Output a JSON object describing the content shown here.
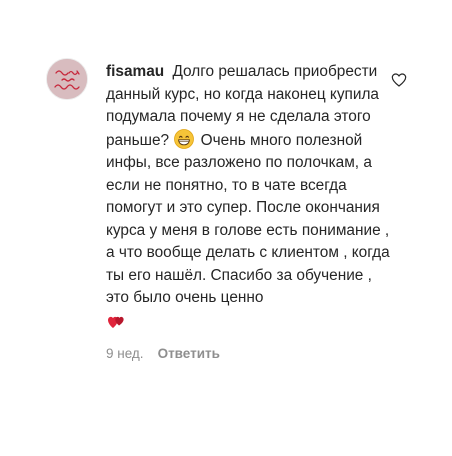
{
  "comment": {
    "username": "fisamau",
    "text_part1": "Долго решалась приобрести данный курс, но когда наконец купила подумала почему я не сделала этого раньше?",
    "emoji1_icon": "grinning-face-icon",
    "text_part2": "Очень много полезной инфы, все разложено по полочкам, а если не понятно, то в чате всегда помогут и это супер. После окончания курса у меня в голове есть понимание , а что вообще делать с клиентом , когда ты его нашёл. Спасибо за обучение , это было очень ценно",
    "emoji2_icon": "two-hearts-icon",
    "avatar_text": "follow your DREAM",
    "timestamp": "9 нед.",
    "reply_label": "Ответить",
    "like_icon": "heart-outline-icon"
  },
  "colors": {
    "text": "#262626",
    "muted": "#8e8e8e",
    "avatar_bg": "#d8bcbf",
    "avatar_ink": "#c7283c"
  }
}
